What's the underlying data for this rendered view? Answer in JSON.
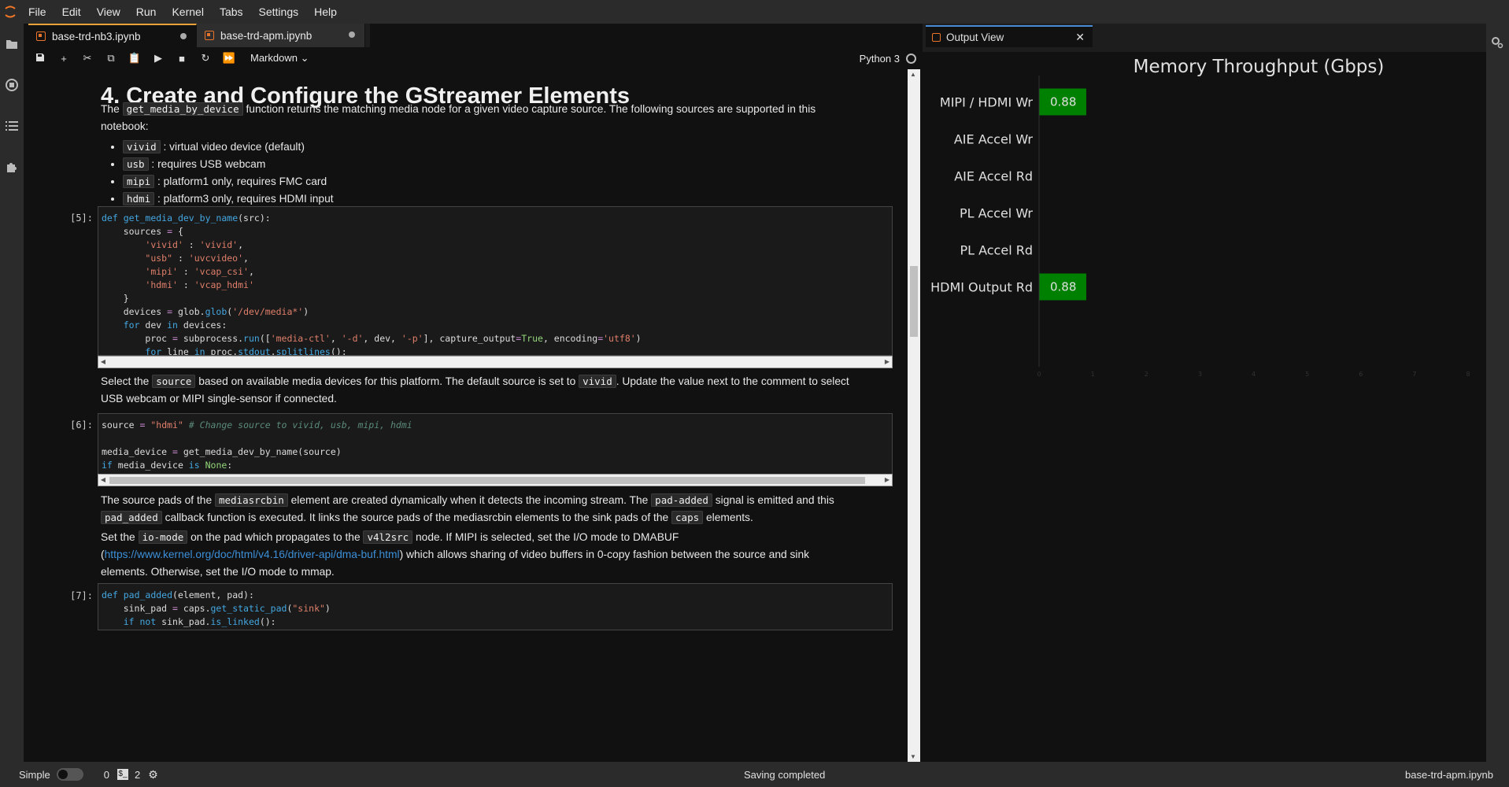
{
  "menubar": {
    "items": [
      "File",
      "Edit",
      "View",
      "Run",
      "Kernel",
      "Tabs",
      "Settings",
      "Help"
    ]
  },
  "tabs": [
    {
      "label": "base-trd-nb3.ipynb"
    },
    {
      "label": "base-trd-apm.ipynb"
    }
  ],
  "toolbar": {
    "cell_type": "Markdown",
    "kernel": "Python 3"
  },
  "notebook": {
    "heading": "4. Create and Configure the GStreamer Elements",
    "p1_a": "The ",
    "p1_code": "get_media_by_device",
    "p1_b": " function returns the matching media node for a given video capture source. The following sources are supported in this",
    "p1_c": "notebook:",
    "bullets": [
      {
        "code": "vivid",
        "text": " : virtual video device (default)"
      },
      {
        "code": "usb",
        "text": " : requires USB webcam"
      },
      {
        "code": "mipi",
        "text": " : platform1 only, requires FMC card"
      },
      {
        "code": "hdmi",
        "text": " : platform3 only, requires HDMI input"
      }
    ],
    "prompt5": "[5]:",
    "prompt6": "[6]:",
    "prompt7": "[7]:",
    "p2_a": "Select the ",
    "p2_code1": "source",
    "p2_b": " based on available media devices for this platform. The default source is set to ",
    "p2_code2": "vivid",
    "p2_c": ". Update the value next to the comment to select",
    "p2_d": "USB webcam or MIPI single-sensor if connected.",
    "p3_a": "The source pads of the ",
    "p3_code1": "mediasrcbin",
    "p3_b": " element are created dynamically when it detects the incoming stream. The ",
    "p3_code2": "pad-added",
    "p3_c": " signal is emitted and this",
    "p3_code3": "pad_added",
    "p3_d": " callback function is executed. It links the source pads of the mediasrcbin elements to the sink pads of the ",
    "p3_code4": "caps",
    "p3_e": " elements.",
    "p4_a": "Set the ",
    "p4_code1": "io-mode",
    "p4_b": " on the pad which propagates to the ",
    "p4_code2": "v4l2src",
    "p4_c": " node. If MIPI is selected, set the I/O mode to DMABUF",
    "p4_d": "(",
    "p4_link": "https://www.kernel.org/doc/html/v4.16/driver-api/dma-buf.html",
    "p4_e": ") which allows sharing of video buffers in 0-copy fashion between the source and sink",
    "p4_f": "elements. Otherwise, set the I/O mode to mmap."
  },
  "output_view": {
    "title": "Output View"
  },
  "chart_data": {
    "type": "bar",
    "orientation": "horizontal",
    "title": "Memory Throughput (Gbps)",
    "categories": [
      "MIPI / HDMI Wr",
      "AIE Accel Wr",
      "AIE Accel Rd",
      "PL Accel Wr",
      "PL Accel Rd",
      "HDMI Output Rd"
    ],
    "values": [
      0.88,
      0,
      0,
      0,
      0,
      0.88
    ],
    "data_labels": [
      "0.88",
      "",
      "",
      "",
      "",
      "0.88"
    ],
    "xlim": [
      0,
      8
    ],
    "xticks": [
      "0",
      "1",
      "2",
      "3",
      "4",
      "5",
      "6",
      "7",
      "8"
    ],
    "bar_color": "#008000",
    "background": "#111111",
    "grid": false
  },
  "statusbar": {
    "mode": "Simple",
    "count1": "0",
    "count2": "2",
    "message": "Saving completed",
    "file": "base-trd-apm.ipynb"
  }
}
